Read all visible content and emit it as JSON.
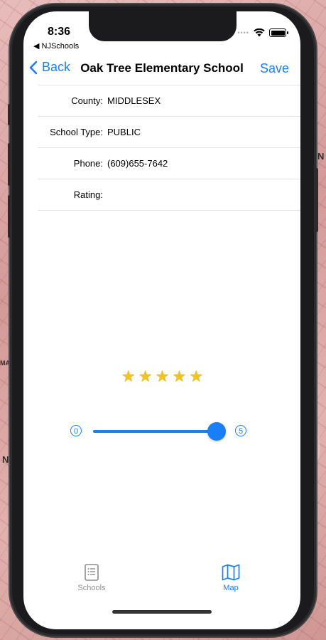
{
  "status": {
    "time": "8:36",
    "back_app": "◀ NJSchools"
  },
  "navbar": {
    "back_label": "Back",
    "title": "Oak Tree Elementary School",
    "save_label": "Save"
  },
  "fields": [
    {
      "label": "County:",
      "value": "MIDDLESEX"
    },
    {
      "label": "School Type:",
      "value": "PUBLIC"
    },
    {
      "label": "Phone:",
      "value": "(609)655-7642"
    },
    {
      "label": "Rating:",
      "value": ""
    }
  ],
  "rating": {
    "stars": 5,
    "max": 5,
    "star_glyph": "★"
  },
  "slider": {
    "min_label": "0",
    "max_label": "5",
    "value": 5,
    "min": 0,
    "max": 5,
    "accent": "#1a7ef7"
  },
  "tabs": [
    {
      "label": "Schools",
      "icon": "list-icon",
      "active": false
    },
    {
      "label": "Map",
      "icon": "map-icon",
      "active": true
    }
  ],
  "colors": {
    "accent": "#1a7ef7",
    "inactive": "#8e8e93",
    "star": "#f3c21d"
  }
}
